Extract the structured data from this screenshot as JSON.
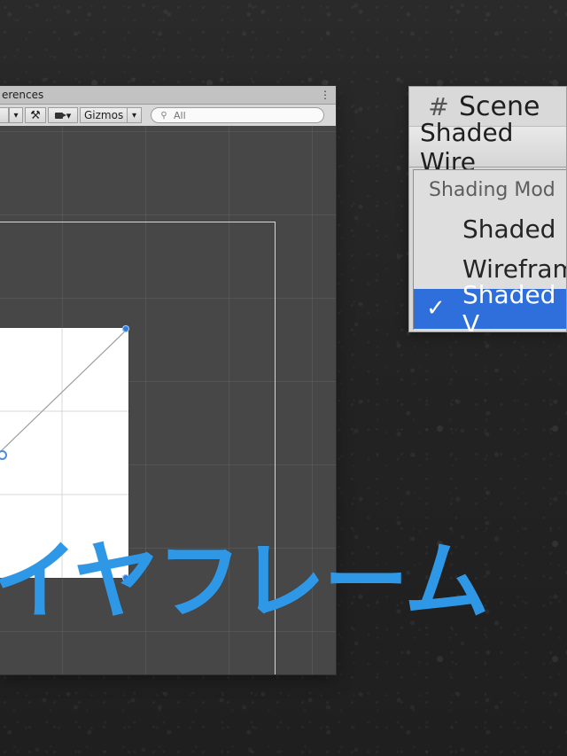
{
  "scene_window": {
    "tab_title": "erences",
    "toolbar": {
      "gizmos_label": "Gizmos",
      "search_placeholder": "All"
    }
  },
  "shading_menu": {
    "header_title": "Scene",
    "selected_mode": "Shaded Wire",
    "section_title": "Shading Mod",
    "items": [
      {
        "label": "Shaded",
        "selected": false
      },
      {
        "label": "Wirefram",
        "selected": false
      },
      {
        "label": "Shaded V",
        "selected": true
      }
    ]
  },
  "caption": {
    "text": "イヤフレーム"
  },
  "icons": {
    "menu_dots": "vertical-ellipsis-icon",
    "tool": "tool-icon",
    "camera": "camera-icon",
    "search": "search-icon",
    "scene": "hash-icon",
    "check": "check-icon"
  },
  "colors": {
    "accent_blue": "#2f98e6",
    "selection_blue": "#2f6fdb",
    "handle_blue": "#2f7de0"
  }
}
